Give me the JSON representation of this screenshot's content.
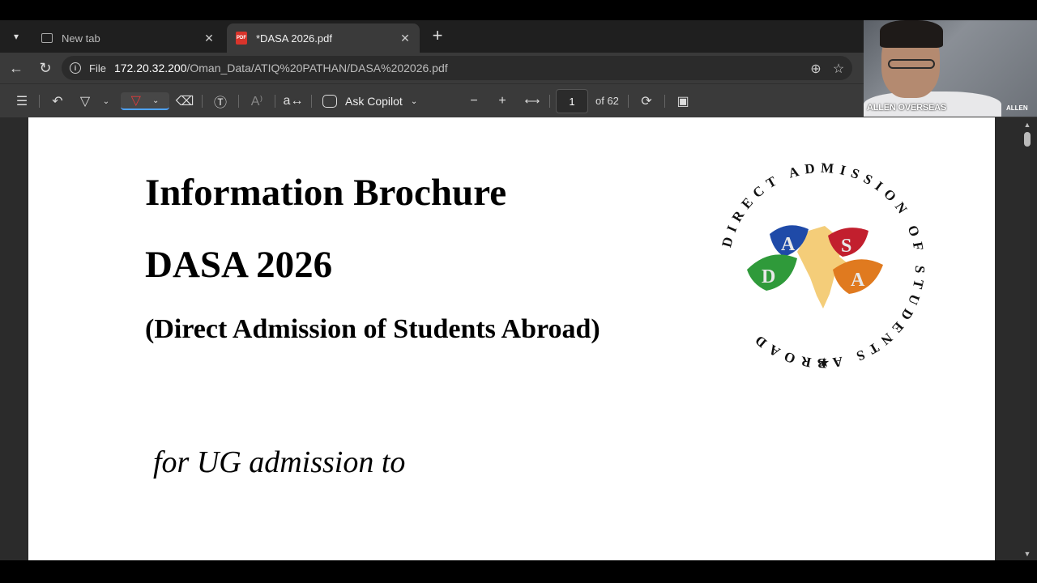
{
  "browser": {
    "tabs": [
      {
        "title": "New tab",
        "icon": "newtab-icon",
        "active": false
      },
      {
        "title": "*DASA 2026.pdf",
        "icon": "pdf-file-icon",
        "active": true
      }
    ],
    "url": {
      "scheme_label": "File",
      "host": "172.20.32.200",
      "path": "/Oman_Data/ATIQ%20PATHAN/DASA%202026.pdf"
    }
  },
  "pdf_toolbar": {
    "copilot_label": "Ask Copilot",
    "page_current": "1",
    "page_total_label": "of 62",
    "icons": [
      "contents-icon",
      "undo-icon",
      "highlight-icon",
      "draw-icon",
      "eraser-icon",
      "text-icon",
      "read-aloud-icon",
      "translate-icon",
      "copilot-icon",
      "zoom-out-icon",
      "zoom-in-icon",
      "fit-width-icon",
      "rotate-icon",
      "page-view-icon"
    ]
  },
  "document": {
    "title": "Information Brochure",
    "subtitle": "DASA 2026",
    "expansion": "(Direct Admission of Students Abroad)",
    "tagline": "for UG admission to",
    "logo_ring_text": "DIRECT ADMISSION OF STUDENTS ABROAD",
    "logo_letters": [
      "D",
      "A",
      "S",
      "A"
    ]
  },
  "webcam": {
    "name_label": "ALLEN OVERSEAS",
    "brand": "ALLEN"
  },
  "colors": {
    "tabstrip": "#1f1f1f",
    "toolbar": "#3a3a3a",
    "viewer_bg": "#2b2b2b",
    "accent": "#4ea3ff",
    "pdf_red": "#d9342b"
  }
}
